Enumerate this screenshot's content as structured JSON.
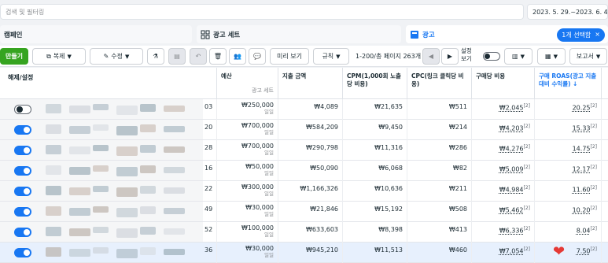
{
  "search": {
    "placeholder": "검색 및 필터링"
  },
  "date_range": "2023. 5. 29.~2023. 6. 4.",
  "tabs": {
    "campaign": "캠페인",
    "adset": "광고 세트",
    "ad": "광고",
    "selected_badge": "1개 선택함",
    "selected_close": "×"
  },
  "toolbar": {
    "create": "만들기",
    "duplicate": "복제",
    "edit": "수정",
    "preview": "미리 보기",
    "rules": "규칙",
    "pagination": "1-200/총 페이지 263개",
    "settings_view": "설정 보기",
    "reports": "보고서"
  },
  "headers": {
    "toggle": "해제/설정",
    "budget": "예산",
    "budget_sub": "광고 세트",
    "spend": "지출 금액",
    "cpm": "CPM(1,000회 노출당 비용)",
    "cpc": "CPC(링크 클릭당 비용)",
    "cost_per_purchase": "구매당 비용",
    "roas": "구매 ROAS(광고 지출 대비 수익률)",
    "roas_sort": "↓"
  },
  "rows": [
    {
      "on": false,
      "idx": "03",
      "budget": "₩250,000",
      "budget_sub": "일일",
      "spend": "₩4,089",
      "cpm": "₩21,635",
      "cpc": "₩511",
      "cpp": "₩2,045",
      "roas": "20.25"
    },
    {
      "on": true,
      "idx": "20",
      "budget": "₩700,000",
      "budget_sub": "일일",
      "spend": "₩584,209",
      "cpm": "₩9,450",
      "cpc": "₩214",
      "cpp": "₩4,203",
      "roas": "15.33"
    },
    {
      "on": true,
      "idx": "28",
      "budget": "₩700,000",
      "budget_sub": "일일",
      "spend": "₩290,798",
      "cpm": "₩11,316",
      "cpc": "₩286",
      "cpp": "₩4,276",
      "roas": "14.75"
    },
    {
      "on": true,
      "idx": "16",
      "budget": "₩50,000",
      "budget_sub": "일일",
      "spend": "₩50,090",
      "cpm": "₩6,068",
      "cpc": "₩82",
      "cpp": "₩5,009",
      "roas": "12.17"
    },
    {
      "on": true,
      "idx": "22",
      "budget": "₩300,000",
      "budget_sub": "일일",
      "spend": "₩1,166,326",
      "cpm": "₩10,636",
      "cpc": "₩211",
      "cpp": "₩4,984",
      "roas": "11.60"
    },
    {
      "on": true,
      "idx": "49",
      "budget": "₩30,000",
      "budget_sub": "일일",
      "spend": "₩21,846",
      "cpm": "₩15,192",
      "cpc": "₩508",
      "cpp": "₩5,462",
      "roas": "10.20"
    },
    {
      "on": true,
      "idx": "52",
      "budget": "₩100,000",
      "budget_sub": "일일",
      "spend": "₩633,603",
      "cpm": "₩8,398",
      "cpc": "₩413",
      "cpp": "₩6,336",
      "roas": "8.04"
    },
    {
      "on": true,
      "idx": "36",
      "budget": "₩30,000",
      "budget_sub": "일일",
      "spend": "₩945,210",
      "cpm": "₩11,513",
      "cpc": "₩460",
      "cpp": "₩7,054",
      "roas": "7.50"
    }
  ],
  "colors": {
    "accent": "#1877f2",
    "create": "#36a420",
    "heart": "#e53935"
  }
}
